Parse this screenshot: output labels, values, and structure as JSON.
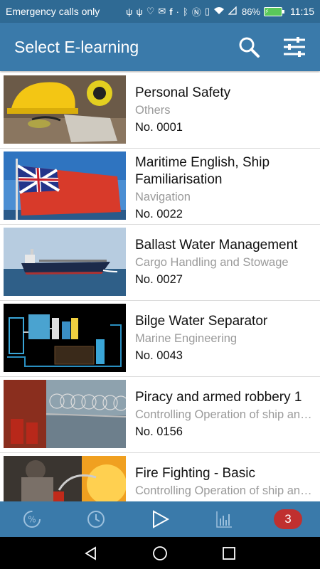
{
  "status_bar": {
    "left_text": "Emergency calls only",
    "icons": [
      "usb-icon",
      "usb-icon",
      "heart-rate-icon",
      "mail-icon",
      "facebook-icon",
      "more-dots-icon",
      "bluetooth-icon",
      "nfc-icon",
      "vibrate-icon",
      "wifi-icon",
      "signal-icon"
    ],
    "battery_percent": "86%",
    "time": "11:15"
  },
  "app_bar": {
    "title": "Select E-learning",
    "actions": [
      "search-icon",
      "filter-sliders-icon"
    ]
  },
  "courses": [
    {
      "title": "Personal Safety",
      "category": "Others",
      "number": "No. 0001",
      "thumb": "safety-gear"
    },
    {
      "title": "Maritime English, Ship Familiarisation",
      "category": "Navigation",
      "number": "No. 0022",
      "thumb": "red-ensign-flag"
    },
    {
      "title": "Ballast Water Management",
      "category": "Cargo Handling and Stowage",
      "number": "No. 0027",
      "thumb": "tanker-ship"
    },
    {
      "title": "Bilge Water Separator",
      "category": "Marine Engineering",
      "number": "No. 0043",
      "thumb": "separator-diagram"
    },
    {
      "title": "Piracy and armed robbery 1",
      "category": "Controlling Operation of ship and care for persons on board",
      "number": "No. 0156",
      "thumb": "razor-wire-deck"
    },
    {
      "title": "Fire Fighting - Basic",
      "category": "Controlling Operation of ship and care for persons on board",
      "number": "",
      "thumb": "fire-extinguisher"
    }
  ],
  "bottom_nav": {
    "items": [
      "percent-progress-icon",
      "history-clock-icon",
      "play-icon",
      "statistics-chart-icon"
    ],
    "badge_count": "3"
  },
  "system_nav": [
    "back-icon",
    "home-icon",
    "recents-icon"
  ],
  "colors": {
    "status_bar": "#2f6a94",
    "app_bar": "#3a7aaa",
    "badge": "#c0302f",
    "category_text": "#9a9a9a"
  }
}
